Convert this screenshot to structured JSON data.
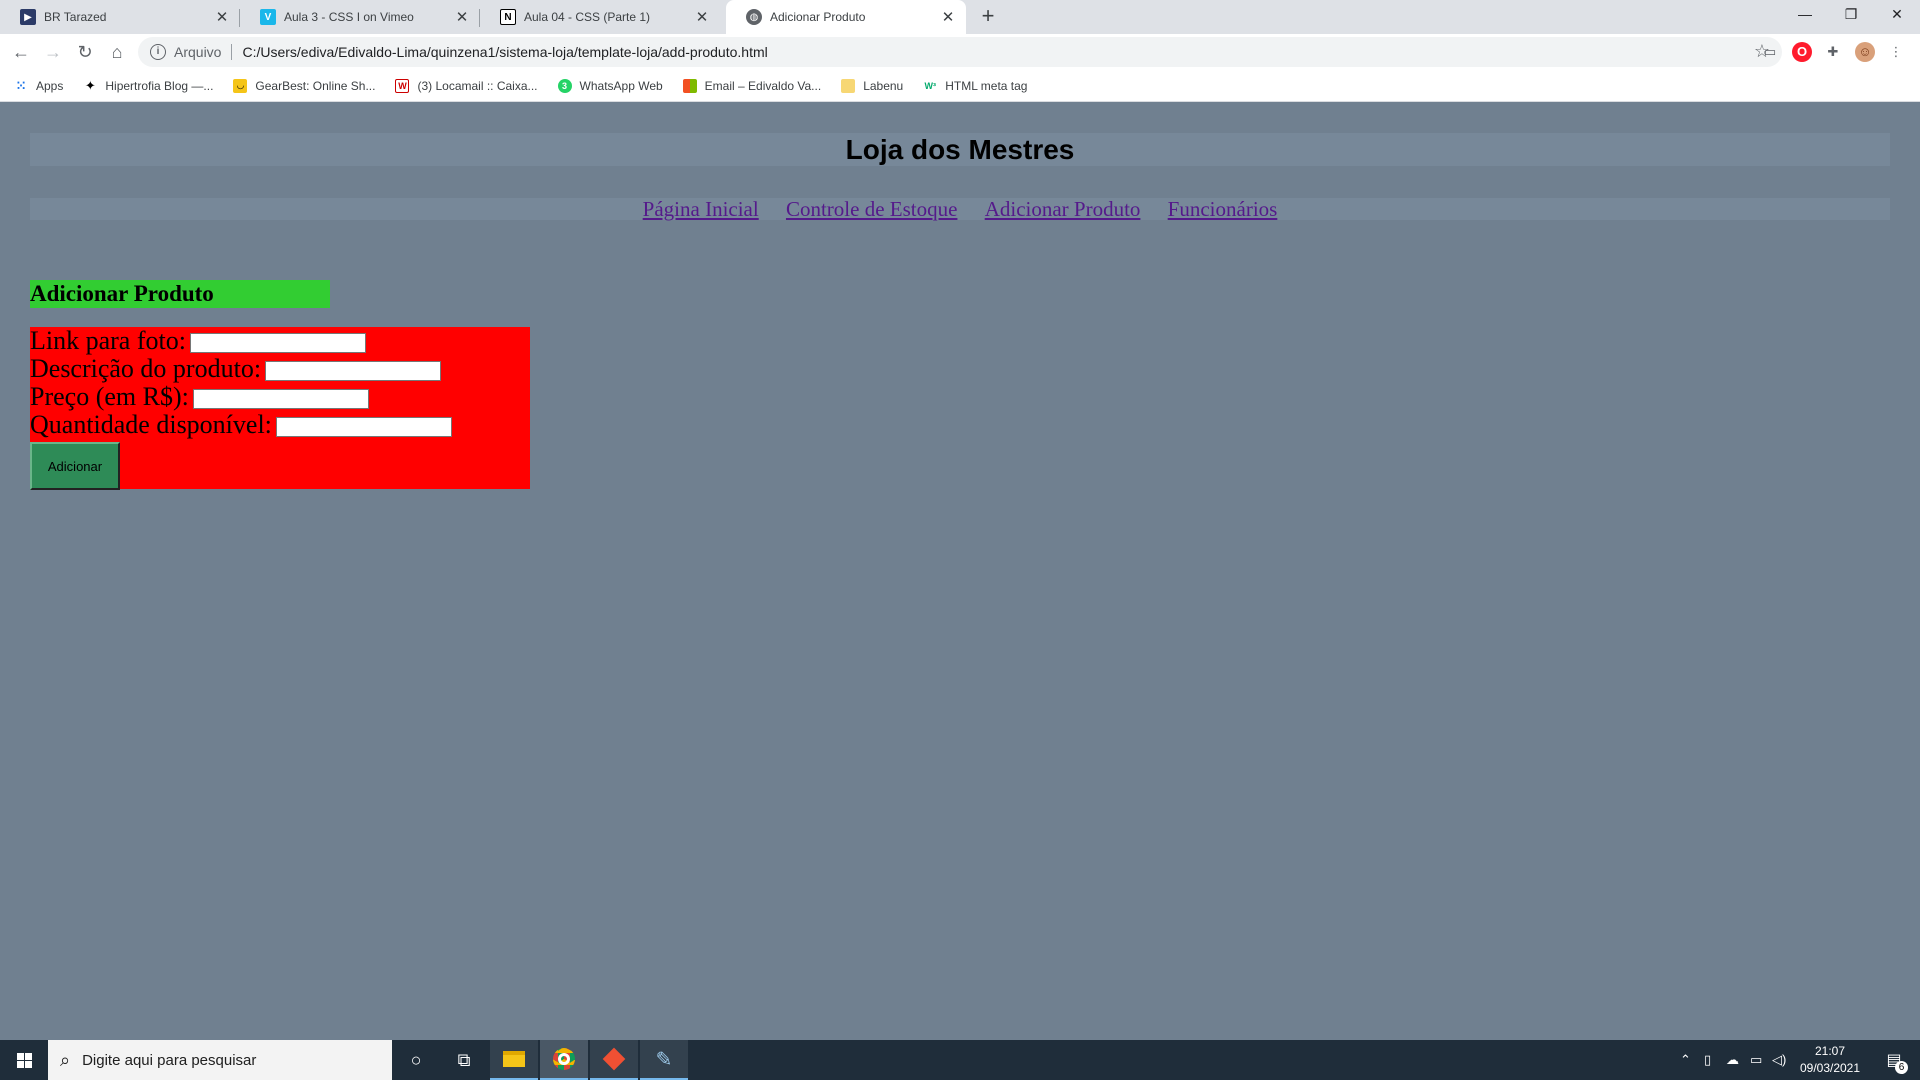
{
  "browser": {
    "tabs": [
      {
        "label": "BR Tarazed",
        "icon": "tarazed-icon",
        "active": false
      },
      {
        "label": "Aula 3 - CSS I on Vimeo",
        "icon": "vimeo-icon",
        "active": false
      },
      {
        "label": "Aula 04 - CSS (Parte 1)",
        "icon": "notion-icon",
        "active": false
      },
      {
        "label": "Adicionar Produto",
        "icon": "globe-icon",
        "active": true
      }
    ],
    "address": {
      "prefix": "Arquivo",
      "url": "C:/Users/ediva/Edivaldo-Lima/quinzena1/sistema-loja/template-loja/add-produto.html"
    },
    "bookmarks": [
      {
        "label": "Apps",
        "icon": "apps-grid-icon"
      },
      {
        "label": "Hipertrofia Blog —...",
        "icon": "hipertrofia-icon"
      },
      {
        "label": "GearBest: Online Sh...",
        "icon": "gearbest-icon"
      },
      {
        "label": "(3) Locamail :: Caixa...",
        "icon": "locamail-icon"
      },
      {
        "label": "WhatsApp Web",
        "icon": "whatsapp-icon"
      },
      {
        "label": "Email – Edivaldo Va...",
        "icon": "microsoft-icon"
      },
      {
        "label": "Labenu",
        "icon": "folder-icon"
      },
      {
        "label": "HTML meta tag",
        "icon": "w3-icon"
      }
    ]
  },
  "page": {
    "site_title": "Loja dos Mestres",
    "nav": [
      "Página Inicial",
      "Controle de Estoque",
      "Adicionar Produto",
      "Funcionários"
    ],
    "section_title": "Adicionar Produto",
    "form": {
      "photo_label": "Link para foto:",
      "description_label": "Descrição do produto:",
      "price_label": "Preço (em R$):",
      "quantity_label": "Quantidade disponível:",
      "photo_value": "",
      "description_value": "",
      "price_value": "",
      "quantity_value": "",
      "submit_label": "Adicionar"
    },
    "colors": {
      "background": "#708090",
      "header_bar": "#778899",
      "section_title_bg": "#32cd32",
      "form_bg": "#ff0000",
      "button_bg": "#2e8b57"
    }
  },
  "taskbar": {
    "search_placeholder": "Digite aqui para pesquisar",
    "time": "21:07",
    "date": "09/03/2021",
    "notification_count": "6"
  }
}
